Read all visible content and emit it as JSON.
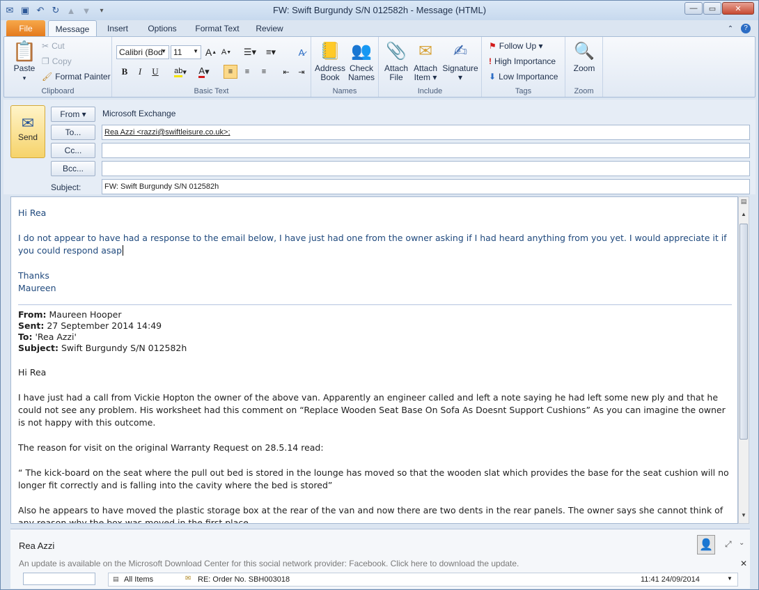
{
  "window": {
    "title": "FW: Swift Burgundy S/N  012582h  -  Message (HTML)"
  },
  "tabs": [
    "File",
    "Message",
    "Insert",
    "Options",
    "Format Text",
    "Review"
  ],
  "ribbon": {
    "clipboard": {
      "label": "Clipboard",
      "paste": "Paste",
      "cut": "Cut",
      "copy": "Copy",
      "format_painter": "Format Painter"
    },
    "basic_text": {
      "label": "Basic Text",
      "font": "Calibri (Bod",
      "size": "11"
    },
    "names": {
      "label": "Names",
      "address_book": [
        "Address",
        "Book"
      ],
      "check_names": [
        "Check",
        "Names"
      ]
    },
    "include": {
      "label": "Include",
      "attach_file": [
        "Attach",
        "File"
      ],
      "attach_item": [
        "Attach",
        "Item ▾"
      ],
      "signature": [
        "Signature",
        "▾"
      ]
    },
    "tags": {
      "label": "Tags",
      "follow_up": "Follow Up ▾",
      "high": "High Importance",
      "low": "Low Importance"
    },
    "zoom": {
      "label": "Zoom",
      "zoom": "Zoom"
    }
  },
  "header": {
    "send": "Send",
    "from_btn": "From ▾",
    "from_value": "Microsoft Exchange",
    "to_btn": "To...",
    "to_value": "Rea Azzi <razzi@swiftleisure.co.uk>;",
    "cc_btn": "Cc...",
    "bcc_btn": "Bcc...",
    "subject_label": "Subject:",
    "subject_value": "FW: Swift Burgundy S/N  012582h"
  },
  "body": {
    "greeting": "Hi Rea",
    "para1": "I do not appear to have had a response to the email below, I have just had one from the owner asking if I had heard anything from you yet.  I would appreciate it if you could respond asap",
    "thanks": "Thanks",
    "signoff": "Maureen",
    "fwd": {
      "from_label": "From:",
      "from": "Maureen Hooper",
      "sent_label": "Sent:",
      "sent": "27 September 2014 14:49",
      "to_label": "To:",
      "to": "'Rea Azzi'",
      "subject_label": "Subject:",
      "subject": "Swift Burgundy S/N 012582h"
    },
    "greeting2": "Hi Rea",
    "para2": "I have just had a call from Vickie Hopton the owner of the above van.  Apparently an engineer called and left a note saying he had left some new ply and that he could not see any problem.  His worksheet had this comment on “Replace Wooden Seat Base On Sofa As Doesnt Support Cushions”  As you can imagine the owner is not happy with this outcome.",
    "para3": "The reason for visit on the original Warranty Request on 28.5.14 read:",
    "para4": "“ The kick-board on the seat where the pull out bed is stored in the lounge has moved so that the wooden slat which provides the base for the seat cushion will no longer fit correctly and is falling into the cavity where the bed is stored”",
    "para5": "Also he appears to  have moved the plastic storage box at the rear of the van and now there are two dents in the rear panels.  The owner says she cannot think of any reason why the box was moved in the first place."
  },
  "people_pane": {
    "name": "Rea Azzi",
    "notice": "An update is available on the Microsoft Download Center for this social network provider: Facebook. Click here to download the update.",
    "filter": "All Items",
    "item_subject": "RE: Order No. SBH003018",
    "item_time": "11:41  24/09/2014"
  }
}
